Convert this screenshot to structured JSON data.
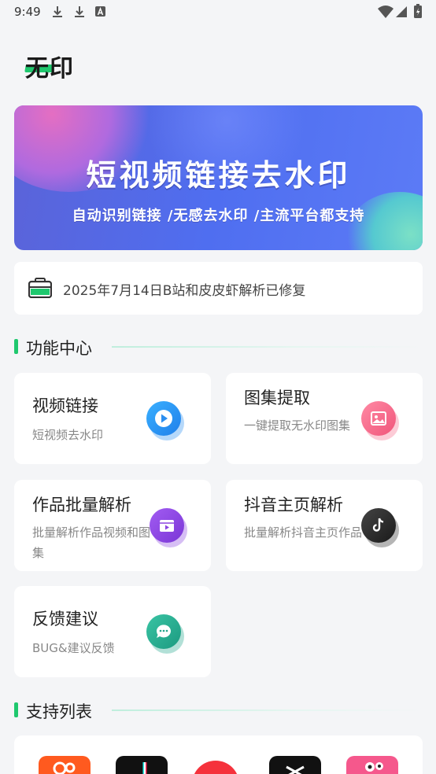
{
  "status_bar": {
    "time": "9:49",
    "icons": [
      "download-icon",
      "download-icon",
      "text-a-icon",
      "wifi-icon",
      "signal-icon",
      "battery-icon"
    ]
  },
  "app": {
    "logo_text": "无印",
    "brand_color": "#1fc86e"
  },
  "banner": {
    "title": "短视频链接去水印",
    "subtitle": "自动识别链接 /无感去水印 /主流平台都支持"
  },
  "notice": {
    "icon": "briefcase-icon",
    "text": "2025年7月14日B站和皮皮虾解析已修复"
  },
  "sections": {
    "features": "功能中心",
    "support": "支持列表"
  },
  "features": [
    {
      "title": "视频链接",
      "desc": "短视频去水印",
      "icon": "play-icon",
      "color": "#2b8ef0"
    },
    {
      "title": "图集提取",
      "desc": "一键提取无水印图集",
      "icon": "image-icon",
      "color": "#f56a8a"
    },
    {
      "title": "作品批量解析",
      "desc": "批量解析作品视频和图集",
      "icon": "video-clip-icon",
      "color": "#8a45e0"
    },
    {
      "title": "抖音主页解析",
      "desc": "批量解析抖音主页作品",
      "icon": "tiktok-icon",
      "color": "#2a2a2a"
    },
    {
      "title": "反馈建议",
      "desc": "BUG&建议反馈",
      "icon": "chat-icon",
      "color": "#22a58c"
    }
  ],
  "support_apps": [
    {
      "icon": "kuaishou-icon",
      "color": "#ff5a1f"
    },
    {
      "icon": "douyin-icon",
      "color": "#111111"
    },
    {
      "icon": "app-red-icon",
      "color": "#f5323c"
    },
    {
      "icon": "capcut-icon",
      "color": "#111111"
    },
    {
      "icon": "pipixia-icon",
      "color": "#f5588c"
    }
  ]
}
